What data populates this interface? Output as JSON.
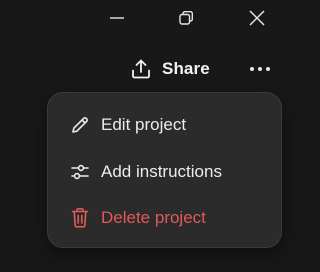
{
  "window_controls": {
    "minimize": "minimize-icon",
    "maximize": "restore-icon",
    "close": "close-icon"
  },
  "header": {
    "share_label": "Share",
    "share_icon": "share-upload-icon",
    "more_icon": "more-horizontal-icon"
  },
  "menu": {
    "items": [
      {
        "label": "Edit project",
        "icon": "pencil-icon"
      },
      {
        "label": "Add instructions",
        "icon": "sliders-icon"
      },
      {
        "label": "Delete project",
        "icon": "trash-icon",
        "color": "#e05a5a"
      }
    ]
  },
  "colors": {
    "background": "#181818",
    "menu_background": "#2b2b2b",
    "text": "#ececec",
    "danger": "#e05a5a"
  }
}
